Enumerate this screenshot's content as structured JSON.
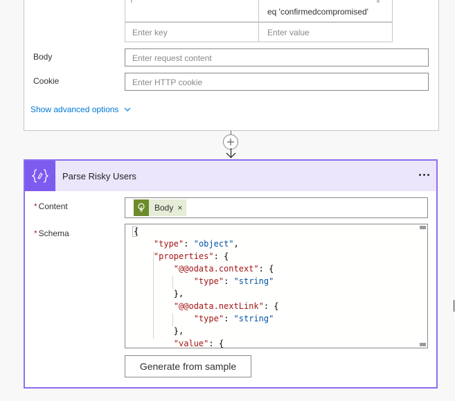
{
  "http_card": {
    "header_value": "eq 'confirmedcompromised'",
    "key_placeholder": "Enter key",
    "value_placeholder": "Enter value",
    "body_label": "Body",
    "body_placeholder": "Enter request content",
    "cookie_label": "Cookie",
    "cookie_placeholder": "Enter HTTP cookie",
    "advanced_link": "Show advanced options"
  },
  "parse_card": {
    "title": "Parse Risky Users",
    "content_label": "Content",
    "content_token": "Body",
    "token_remove": "×",
    "schema_label": "Schema",
    "schema_lines": {
      "l1": "{",
      "l2_key": "\"type\"",
      "l2_val": "\"object\"",
      "l3_key": "\"properties\"",
      "l4_key": "\"@@odata.context\"",
      "l5_key": "\"type\"",
      "l5_val": "\"string\"",
      "l6": "},",
      "l7_key": "\"@@odata.nextLink\"",
      "l8_key": "\"type\"",
      "l8_val": "\"string\"",
      "l9": "},",
      "l10_key": "\"value\""
    },
    "generate_button": "Generate from sample"
  },
  "colors": {
    "parse_accent": "#7e5bef",
    "parse_header_bg": "#ebe6fc",
    "token_icon_bg": "#6e8b2c",
    "link": "#0078d4"
  },
  "icons": {
    "parse_icon": "curly-braces-icon",
    "token_icon": "lightbulb-icon",
    "more_icon": "ellipsis-icon",
    "insert_icon": "plus-circle-icon",
    "advanced_icon": "chevron-down-icon"
  }
}
